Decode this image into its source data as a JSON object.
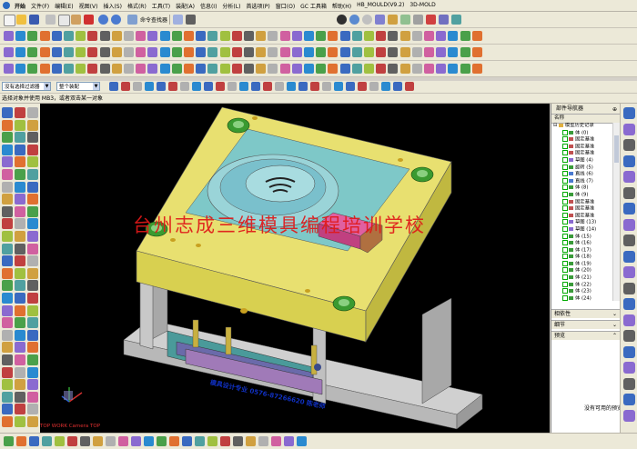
{
  "menu": {
    "start": "开始",
    "items": [
      "文件(F)",
      "编辑(E)",
      "视图(V)",
      "插入(S)",
      "格式(R)",
      "工具(T)",
      "装配(A)",
      "信息(I)",
      "分析(L)",
      "首选项(P)",
      "窗口(O)",
      "GC 工具箱",
      "帮助(H)",
      "HB_MOULD(V9.2)",
      "3D-MOLD"
    ],
    "command_finder": "命令查找器"
  },
  "filter": {
    "type_filter": "没有选择过滤器",
    "assembly_scope": "整个装配"
  },
  "cue_line": "选择对象并使用 MB3，或者双击某一对象",
  "viewport": {
    "watermark": "台州志成三维模具编程培训学校",
    "plate_text": "模具设计专业 0576-87266620 陈老师",
    "view_label": "TOP WORK Camera TOP"
  },
  "part_navigator": {
    "title": "部件导航器",
    "column_name": "名称",
    "root": "模型历史记录",
    "nodes": [
      {
        "label": "体 (0)",
        "color": "#3a9a3a"
      },
      {
        "label": "固定基准",
        "color": "#c05050"
      },
      {
        "label": "固定基准",
        "color": "#c05050"
      },
      {
        "label": "固定基准",
        "color": "#c05050"
      },
      {
        "label": "草图 (4)",
        "color": "#8a6ad0"
      },
      {
        "label": "旋转 (5)",
        "color": "#3a9a3a"
      },
      {
        "label": "直线 (6)",
        "color": "#4a7ad0"
      },
      {
        "label": "直线 (7)",
        "color": "#4a7ad0"
      },
      {
        "label": "体 (8)",
        "color": "#3a9a3a"
      },
      {
        "label": "体 (9)",
        "color": "#3a9a3a"
      },
      {
        "label": "固定基准",
        "color": "#c05050"
      },
      {
        "label": "固定基准",
        "color": "#c05050"
      },
      {
        "label": "固定基准",
        "color": "#c05050"
      },
      {
        "label": "草图 (13)",
        "color": "#8a6ad0"
      },
      {
        "label": "草图 (14)",
        "color": "#8a6ad0"
      },
      {
        "label": "体 (15)",
        "color": "#3a9a3a"
      },
      {
        "label": "体 (16)",
        "color": "#3a9a3a"
      },
      {
        "label": "体 (17)",
        "color": "#3a9a3a"
      },
      {
        "label": "体 (18)",
        "color": "#3a9a3a"
      },
      {
        "label": "体 (19)",
        "color": "#3a9a3a"
      },
      {
        "label": "体 (20)",
        "color": "#3a9a3a"
      },
      {
        "label": "体 (21)",
        "color": "#3a9a3a"
      },
      {
        "label": "体 (22)",
        "color": "#3a9a3a"
      },
      {
        "label": "体 (23)",
        "color": "#3a9a3a"
      },
      {
        "label": "体 (24)",
        "color": "#3a9a3a"
      }
    ],
    "sections": {
      "dependencies": "相依性",
      "details": "细节",
      "preview": "预览"
    },
    "no_preview": "没有可用的预览"
  }
}
